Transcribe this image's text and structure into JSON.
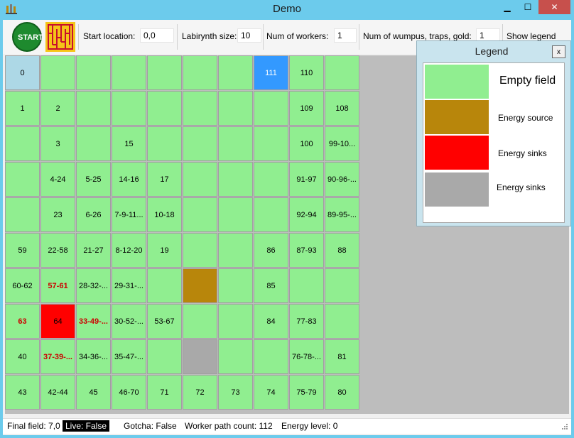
{
  "window": {
    "title": "Demo",
    "minimize": "▁",
    "maximize": "☐",
    "close": "✕"
  },
  "toolbar": {
    "start_label": "START",
    "start_location_label": "Start location:",
    "start_location_value": "0,0",
    "labyrinth_size_label": "Labirynth size:",
    "labyrinth_size_value": "10",
    "num_workers_label": "Num of workers:",
    "num_workers_value": "1",
    "num_wumpus_label": "Num of wumpus, traps, gold:",
    "num_wumpus_value": "1",
    "show_legend": "Show legend"
  },
  "grid": {
    "rows": [
      [
        "0",
        "",
        "",
        "",
        "",
        "",
        "",
        "111",
        "110",
        ""
      ],
      [
        "1",
        "2",
        "",
        "",
        "",
        "",
        "",
        "",
        "109",
        "108"
      ],
      [
        "",
        "3",
        "",
        "15",
        "",
        "",
        "",
        "",
        "100",
        "99-10..."
      ],
      [
        "",
        "4-24",
        "5-25",
        "14-16",
        "17",
        "",
        "",
        "",
        "91-97",
        "90-96-..."
      ],
      [
        "",
        "23",
        "6-26",
        "7-9-11...",
        "10-18",
        "",
        "",
        "",
        "92-94",
        "89-95-..."
      ],
      [
        "59",
        "22-58",
        "21-27",
        "8-12-20",
        "19",
        "",
        "",
        "86",
        "87-93",
        "88"
      ],
      [
        "60-62",
        "57-61",
        "28-32-...",
        "29-31-...",
        "",
        "",
        "",
        "85",
        "",
        ""
      ],
      [
        "63",
        "64",
        "33-49-...",
        "30-52-...",
        "53-67",
        "",
        "",
        "84",
        "77-83",
        ""
      ],
      [
        "40",
        "37-39-...",
        "34-36-...",
        "35-47-...",
        "",
        "",
        "",
        "",
        "76-78-...",
        "81"
      ],
      [
        "43",
        "42-44",
        "45",
        "46-70",
        "71",
        "72",
        "73",
        "74",
        "75-79",
        "80"
      ]
    ],
    "types": [
      [
        "start",
        "",
        "",
        "",
        "",
        "",
        "",
        "current",
        "",
        ""
      ],
      [
        "",
        "",
        "",
        "",
        "",
        "",
        "",
        "",
        "",
        ""
      ],
      [
        "",
        "",
        "",
        "",
        "",
        "",
        "",
        "",
        "",
        ""
      ],
      [
        "",
        "",
        "",
        "",
        "",
        "",
        "",
        "",
        "",
        ""
      ],
      [
        "",
        "",
        "",
        "",
        "",
        "",
        "",
        "",
        "",
        ""
      ],
      [
        "",
        "",
        "",
        "",
        "",
        "",
        "",
        "",
        "",
        ""
      ],
      [
        "",
        "red-text",
        "",
        "",
        "",
        "source",
        "",
        "",
        "",
        ""
      ],
      [
        "red-text",
        "sink",
        "red-text",
        "",
        "",
        "",
        "",
        "",
        "",
        ""
      ],
      [
        "",
        "red-text",
        "",
        "",
        "",
        "gray",
        "",
        "",
        "",
        ""
      ],
      [
        "",
        "",
        "",
        "",
        "",
        "",
        "",
        "",
        "",
        ""
      ]
    ]
  },
  "legend": {
    "title": "Legend",
    "close": "x",
    "items": [
      {
        "label": "Empty field",
        "color": "#90ee90"
      },
      {
        "label": "Energy source",
        "color": "#b8860b"
      },
      {
        "label": "Energy sinks",
        "color": "#ff0000"
      },
      {
        "label": "Energy sinks",
        "color": "#a9a9a9"
      }
    ]
  },
  "status": {
    "final_field": "Final field: 7,0",
    "live": "Live: False",
    "gotcha": "Gotcha: False",
    "worker_path_count": "Worker path count: 112",
    "energy_level": "Energy level: 0"
  },
  "colors": {
    "empty": "#90ee90",
    "start": "#add8e6",
    "current": "#3399ff",
    "source": "#b8860b",
    "sink": "#ff0000",
    "gray": "#a9a9a9",
    "titlebar": "#6ccbec",
    "close_button": "#c7504c"
  }
}
